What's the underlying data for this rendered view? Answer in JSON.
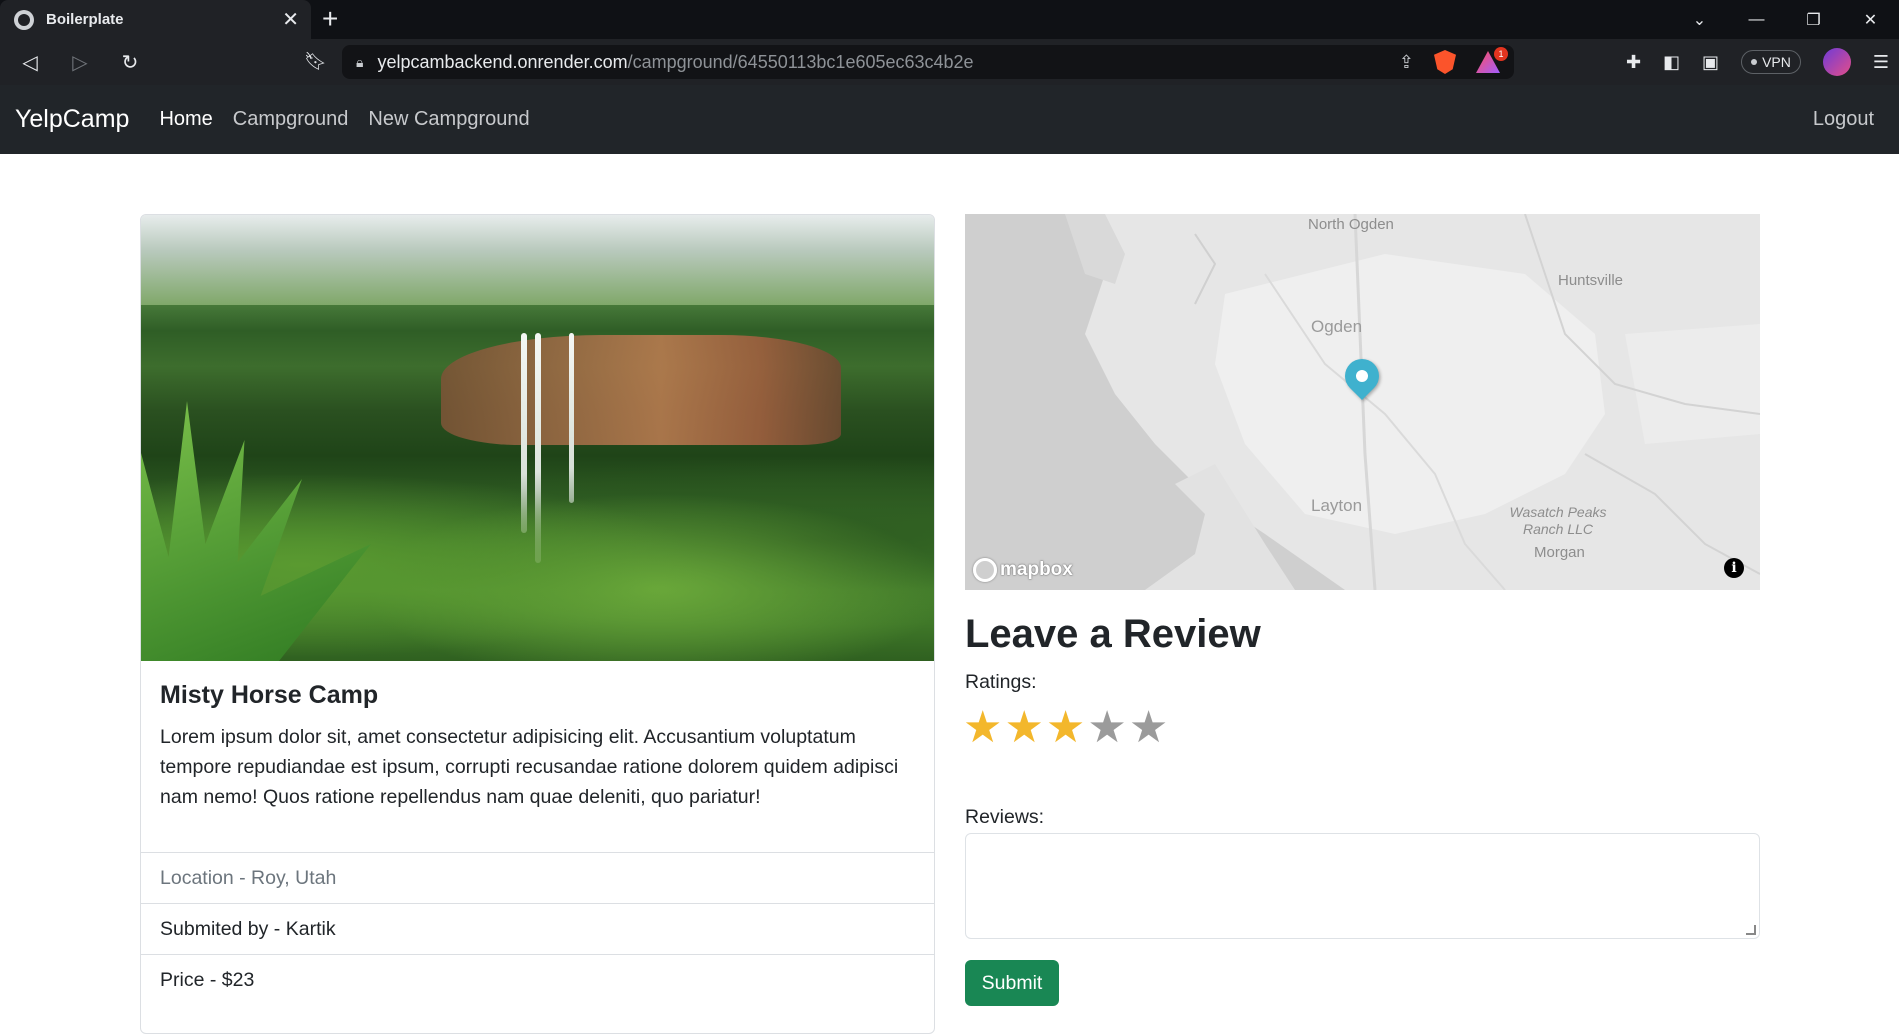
{
  "browser": {
    "tab_title": "Boilerplate",
    "tab_close": "✕",
    "new_tab": "+",
    "url_host": "yelpcambackend.onrender.com",
    "url_path": "/campground/64550113bc1e605ec63c4b2e",
    "rewards_badge": "1",
    "vpn_label": "VPN",
    "window_controls": [
      "⌄",
      "—",
      "❐",
      "✕"
    ]
  },
  "navbar": {
    "brand": "YelpCamp",
    "links": [
      "Home",
      "Campground",
      "New Campground"
    ],
    "active_link": "Home",
    "logout": "Logout"
  },
  "campground": {
    "title": "Misty Horse Camp",
    "description": "Lorem ipsum dolor sit, amet consectetur adipisicing elit. Accusantium voluptatum tempore repudiandae est ipsum, corrupti recusandae ratione dolorem quidem adipisci nam nemo! Quos ratione repellendus nam quae deleniti, quo pariatur!",
    "location": "Location - Roy, Utah",
    "submitted_by": "Submited by - Kartik",
    "price": "Price - $23"
  },
  "map": {
    "labels": {
      "north_ogden": "North Ogden",
      "huntsville": "Huntsville",
      "ogden": "Ogden",
      "layton": "Layton",
      "wasatch_line1": "Wasatch Peaks",
      "wasatch_line2": "Ranch LLC",
      "morgan": "Morgan"
    },
    "attribution": "mapbox",
    "info": "i",
    "pin_color": "#3fb1ce"
  },
  "review": {
    "heading": "Leave a Review",
    "ratings_label": "Ratings:",
    "rating_value": 3,
    "rating_max": 5,
    "reviews_label": "Reviews:",
    "submit_label": "Submit"
  },
  "colors": {
    "navbar_bg": "#212529",
    "submit_bg": "#198754",
    "star_on": "#f3b72c",
    "star_off": "#9b9b9b"
  }
}
